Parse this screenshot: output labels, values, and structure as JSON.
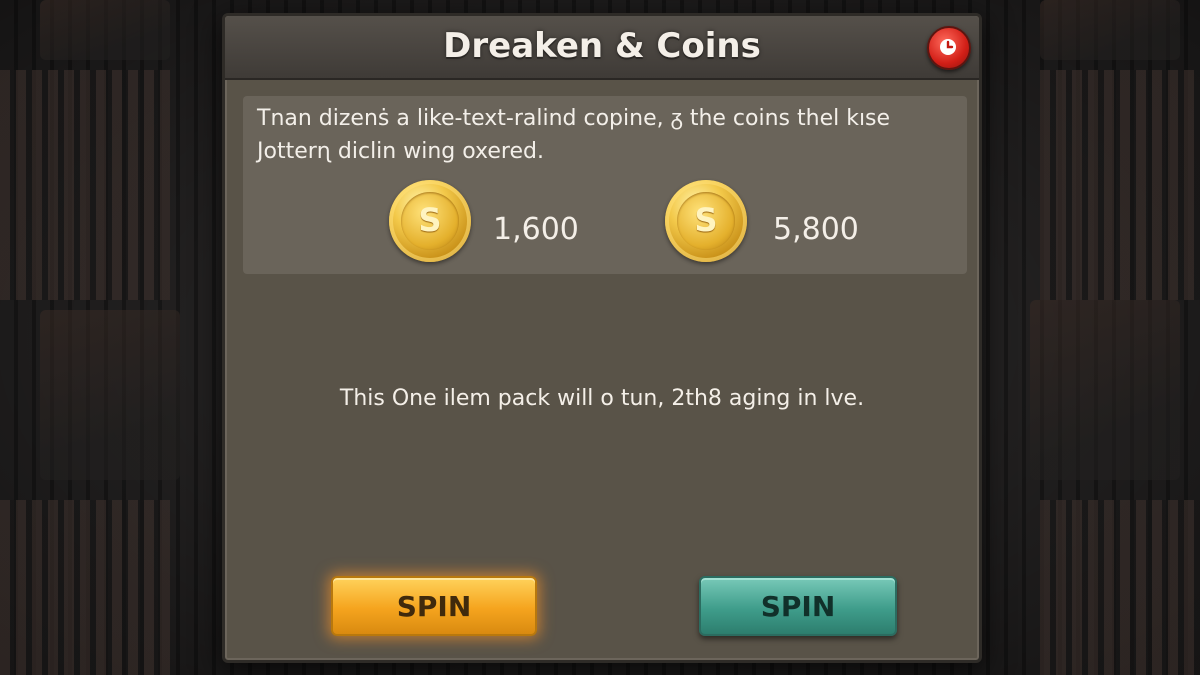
{
  "dialog": {
    "title": "Dreaken & Coins",
    "description": "Tnan dizenṡ a like-text-ralind copine, ᵹ the coins thel kıse Jotterɳ diclin wing oxered.",
    "coins": [
      {
        "amount": "1,600",
        "symbol": "S"
      },
      {
        "amount": "5,800",
        "symbol": "S"
      }
    ],
    "message": "This One ilem pack will o tun, 2th8 aging in lve.",
    "buttons": {
      "left_label": "SPIN",
      "right_label": "SPIN"
    }
  },
  "colors": {
    "panel": "#595348",
    "close": "#d21f17",
    "gold_button": "#f5a41e",
    "teal_button": "#3f9d8b",
    "coin": "#e4b02c"
  },
  "icons": {
    "close": "close-clock-icon",
    "coin": "dollar-coin-icon"
  }
}
